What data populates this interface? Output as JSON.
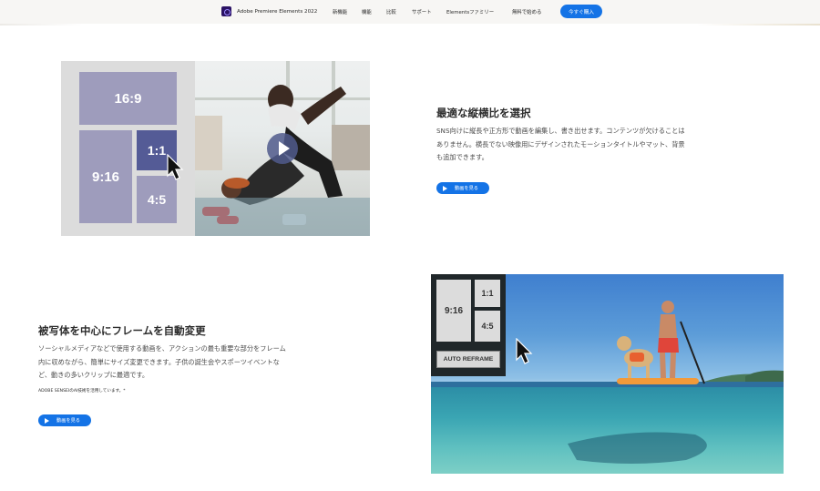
{
  "nav": {
    "brand": "Adobe Premiere Elements 2022",
    "items": [
      "新機能",
      "機能",
      "比較",
      "サポート",
      "Elementsファミリー",
      "無料で始める"
    ],
    "buy": "今すぐ購入"
  },
  "section1": {
    "ratios": [
      "16:9",
      "9:16",
      "1:1",
      "4:5"
    ],
    "title": "最適な縦横比を選択",
    "body": [
      "SNS向けに縦長や正方形で動画を編集し、書き出せます。コンテンツが欠けることは",
      "ありません。横長でない映像用にデザインされたモーションタイトルやマット、背景",
      "も追加できます。"
    ],
    "button": "動画を見る"
  },
  "section2": {
    "title": "被写体を中心にフレームを自動変更",
    "body": [
      "ソーシャルメディアなどで使用する動画を、アクションの最も重要な部分をフレーム",
      "内に収めながら、簡単にサイズ変更できます。子供の誕生会やスポーツイベントな",
      "ど、動きの多いクリップに最適です。"
    ],
    "note": "ADOBE SENSEIのAI技術を活用しています。*",
    "button": "動画を見る",
    "ratios": [
      "9:16",
      "1:1",
      "4:5"
    ],
    "reframe": "AUTO REFRAME"
  },
  "colors": {
    "accent": "#1473e6",
    "tile": "#9e9cbc",
    "tile_active": "#545b96"
  },
  "icons": [
    "premiere-elements-logo-icon",
    "play-icon",
    "cursor-icon"
  ]
}
